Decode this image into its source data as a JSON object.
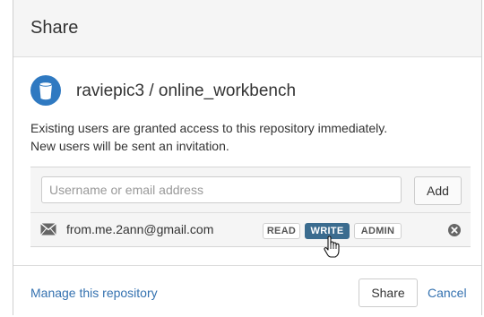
{
  "dialog": {
    "title": "Share"
  },
  "repository": {
    "name": "raviepic3 / online_workbench",
    "avatar_icon": "repository-bucket-icon",
    "avatar_color": "#2f79c1"
  },
  "info_lines": [
    "Existing users are granted access to this repository immediately.",
    "New users will be sent an invitation."
  ],
  "add_user": {
    "placeholder": "Username or email address",
    "value": "",
    "button_label": "Add"
  },
  "users": [
    {
      "email": "from.me.2ann@gmail.com",
      "icon": "envelope-icon",
      "permissions": [
        "READ",
        "WRITE",
        "ADMIN"
      ],
      "selected_permission": "WRITE",
      "remove_icon": "remove-circle-icon"
    }
  ],
  "footer": {
    "manage_link": "Manage this repository",
    "share_label": "Share",
    "cancel_label": "Cancel"
  },
  "colors": {
    "link": "#3572b0",
    "active_permission": "#3b6c8f",
    "header_background": "#f5f5f5"
  },
  "cursor_icon": "hand-pointer-icon"
}
